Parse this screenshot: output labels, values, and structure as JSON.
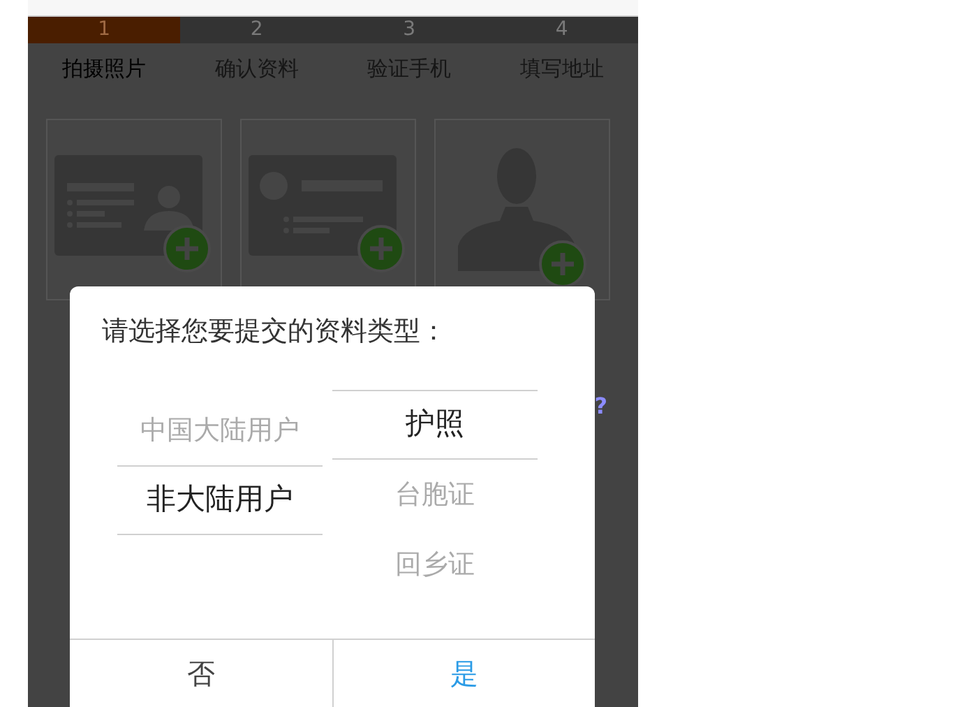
{
  "steps": [
    {
      "number": "1",
      "selected": true
    },
    {
      "number": "2",
      "selected": false
    },
    {
      "number": "3",
      "selected": false
    },
    {
      "number": "4",
      "selected": false
    }
  ],
  "step_labels": [
    {
      "label": "拍摄照片",
      "selected": true
    },
    {
      "label": "确认资料",
      "selected": false
    },
    {
      "label": "验证手机",
      "selected": false
    },
    {
      "label": "填写地址",
      "selected": false
    }
  ],
  "upload_cards": [
    {
      "kind": "id-front"
    },
    {
      "kind": "id-back"
    },
    {
      "kind": "portrait"
    }
  ],
  "covered_link": "?",
  "dialog": {
    "title": "请选择您要提交的资料类型：",
    "picker_columns": [
      {
        "options": [
          {
            "label": "中国大陆用户",
            "selected": false
          },
          {
            "label": "非大陆用户",
            "selected": true
          }
        ]
      },
      {
        "options": [
          {
            "label": "护照",
            "selected": true
          },
          {
            "label": "台胞证",
            "selected": false
          },
          {
            "label": "回乡证",
            "selected": false
          }
        ]
      }
    ],
    "buttons": [
      {
        "label": "否",
        "kind": "cancel"
      },
      {
        "label": "是",
        "kind": "confirm"
      }
    ]
  }
}
